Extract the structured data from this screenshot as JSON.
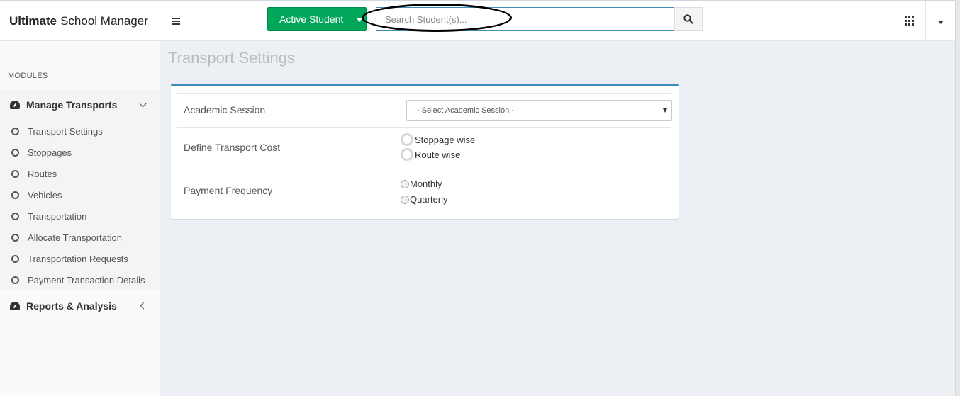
{
  "header": {
    "brand_bold": "Ultimate",
    "brand_rest": "School Manager",
    "active_student_label": "Active Student",
    "search_placeholder": "Search Student(s)..."
  },
  "sidebar": {
    "modules_label": "MODULES",
    "manage_transports": "Manage Transports",
    "items": [
      {
        "label": "Transport Settings"
      },
      {
        "label": "Stoppages"
      },
      {
        "label": "Routes"
      },
      {
        "label": "Vehicles"
      },
      {
        "label": "Transportation"
      },
      {
        "label": "Allocate Transportation"
      },
      {
        "label": "Transportation Requests"
      },
      {
        "label": "Payment Transaction Details"
      }
    ],
    "reports": "Reports & Analysis"
  },
  "main": {
    "title": "Transport Settings",
    "session_label": "Academic Session",
    "session_select": "- Select Academic Session -",
    "cost_label": "Define Transport Cost",
    "cost_options": [
      "Stoppage wise",
      "Route wise"
    ],
    "freq_label": "Payment Frequency",
    "freq_options": [
      "Monthly",
      "Quarterly"
    ]
  },
  "colors": {
    "accent": "#3c8dbc",
    "success": "#00a65a",
    "background": "#ecf0f5"
  }
}
